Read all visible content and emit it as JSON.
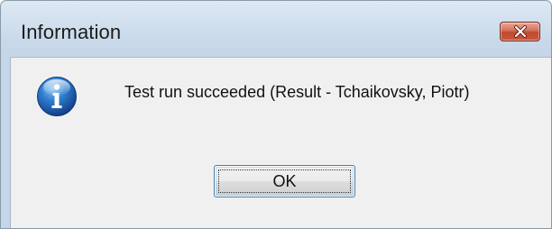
{
  "dialog": {
    "title": "Information",
    "close_icon": "close-icon",
    "icon": "info-icon",
    "message": "Test run succeeded (Result - Tchaikovsky, Piotr)",
    "ok_label": "OK"
  },
  "colors": {
    "titlebar": "#c9d9ea",
    "client_background": "#f0f0f0",
    "close_button": "#c94b31",
    "ok_border": "#3c7fb1",
    "info_icon": "#1c63b7"
  }
}
